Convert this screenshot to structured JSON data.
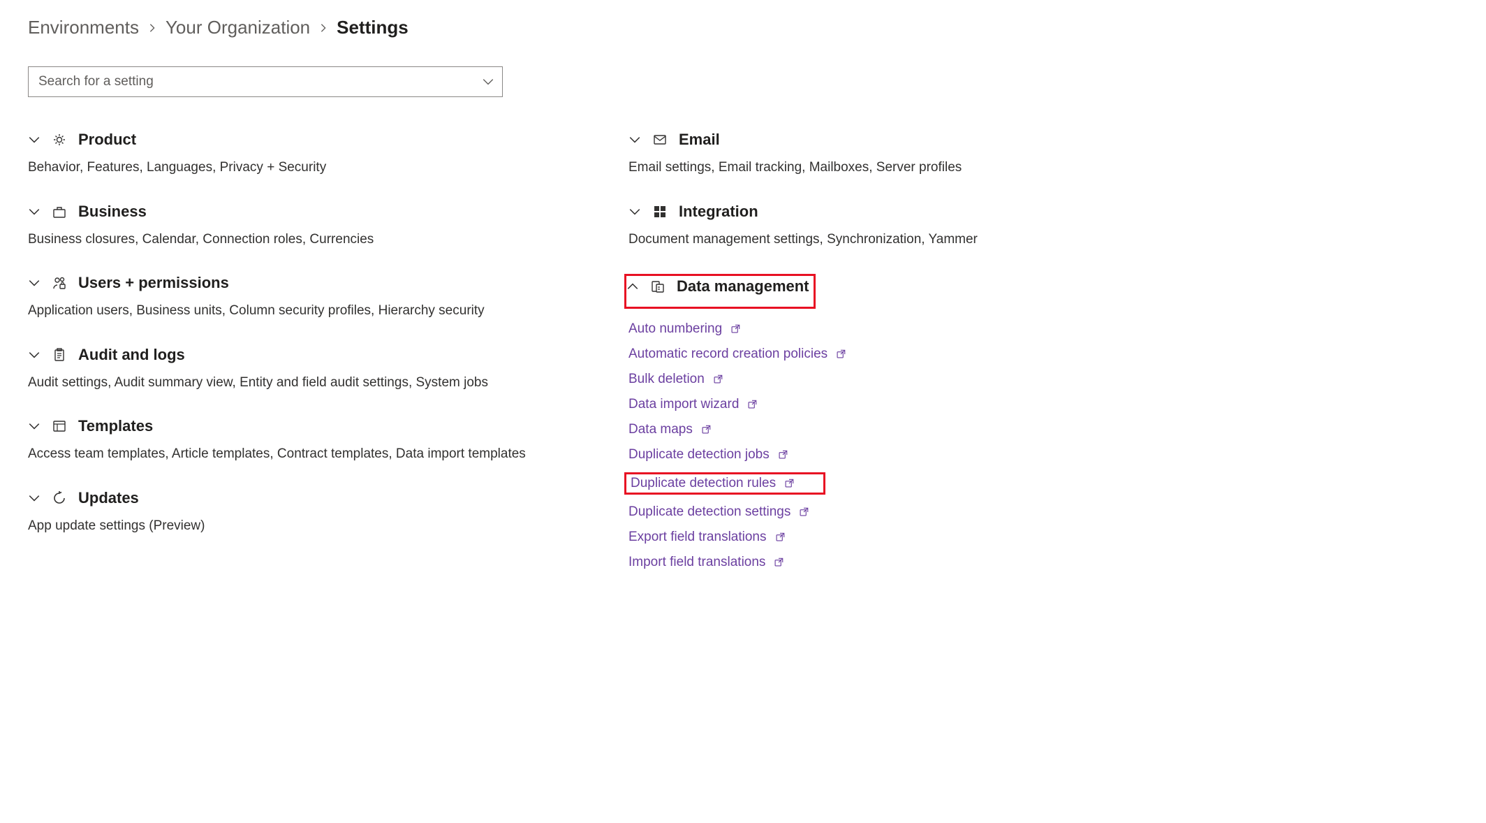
{
  "breadcrumb": {
    "items": [
      "Environments",
      "Your Organization"
    ],
    "current": "Settings"
  },
  "search": {
    "placeholder": "Search for a setting"
  },
  "left": [
    {
      "key": "product",
      "title": "Product",
      "icon": "gear",
      "desc": "Behavior, Features, Languages, Privacy + Security",
      "expanded": false
    },
    {
      "key": "business",
      "title": "Business",
      "icon": "briefcase",
      "desc": "Business closures, Calendar, Connection roles, Currencies",
      "expanded": false
    },
    {
      "key": "users",
      "title": "Users + permissions",
      "icon": "people-lock",
      "desc": "Application users, Business units, Column security profiles, Hierarchy security",
      "expanded": false
    },
    {
      "key": "audit",
      "title": "Audit and logs",
      "icon": "clipboard",
      "desc": "Audit settings, Audit summary view, Entity and field audit settings, System jobs",
      "expanded": false
    },
    {
      "key": "templates",
      "title": "Templates",
      "icon": "template",
      "desc": "Access team templates, Article templates, Contract templates, Data import templates",
      "expanded": false
    },
    {
      "key": "updates",
      "title": "Updates",
      "icon": "refresh",
      "desc": "App update settings (Preview)",
      "expanded": false
    }
  ],
  "right": [
    {
      "key": "email",
      "title": "Email",
      "icon": "mail",
      "desc": "Email settings, Email tracking, Mailboxes, Server profiles",
      "expanded": false
    },
    {
      "key": "integration",
      "title": "Integration",
      "icon": "windows",
      "desc": "Document management settings, Synchronization, Yammer",
      "expanded": false
    },
    {
      "key": "datamgmt",
      "title": "Data management",
      "icon": "data",
      "expanded": true,
      "highlight": true,
      "links": [
        {
          "label": "Auto numbering",
          "highlight": false
        },
        {
          "label": "Automatic record creation policies",
          "highlight": false
        },
        {
          "label": "Bulk deletion",
          "highlight": false
        },
        {
          "label": "Data import wizard",
          "highlight": false
        },
        {
          "label": "Data maps",
          "highlight": false
        },
        {
          "label": "Duplicate detection jobs",
          "highlight": false
        },
        {
          "label": "Duplicate detection rules",
          "highlight": true
        },
        {
          "label": "Duplicate detection settings",
          "highlight": false
        },
        {
          "label": "Export field translations",
          "highlight": false
        },
        {
          "label": "Import field translations",
          "highlight": false
        }
      ]
    }
  ]
}
